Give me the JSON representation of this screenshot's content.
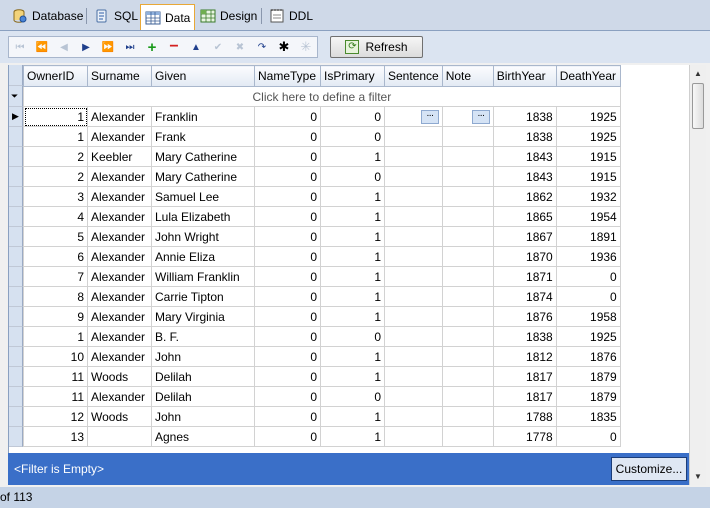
{
  "tabs": [
    {
      "label": "Database",
      "icon": "database-icon"
    },
    {
      "label": "SQL",
      "icon": "sql-scroll-icon"
    },
    {
      "label": "Data",
      "icon": "data-grid-icon",
      "active": true
    },
    {
      "label": "Design",
      "icon": "design-grid-icon"
    },
    {
      "label": "DDL",
      "icon": "ddl-notepad-icon"
    }
  ],
  "toolbar": {
    "refresh_label": "Refresh"
  },
  "grid": {
    "filter_placeholder": "Click here to define a filter",
    "columns": [
      "OwnerID",
      "Surname",
      "Given",
      "NameType",
      "IsPrimary",
      "Sentence",
      "Note",
      "BirthYear",
      "DeathYear"
    ],
    "rows": [
      [
        "1",
        "Alexander",
        "Franklin",
        "0",
        "0",
        "...",
        "...",
        "1838",
        "1925"
      ],
      [
        "1",
        "Alexander",
        "Frank",
        "0",
        "0",
        "",
        "",
        "1838",
        "1925"
      ],
      [
        "2",
        "Keebler",
        "Mary Catherine",
        "0",
        "1",
        "",
        "",
        "1843",
        "1915"
      ],
      [
        "2",
        "Alexander",
        "Mary Catherine",
        "0",
        "0",
        "",
        "",
        "1843",
        "1915"
      ],
      [
        "3",
        "Alexander",
        "Samuel Lee",
        "0",
        "1",
        "",
        "",
        "1862",
        "1932"
      ],
      [
        "4",
        "Alexander",
        "Lula Elizabeth",
        "0",
        "1",
        "",
        "",
        "1865",
        "1954"
      ],
      [
        "5",
        "Alexander",
        "John Wright",
        "0",
        "1",
        "",
        "",
        "1867",
        "1891"
      ],
      [
        "6",
        "Alexander",
        "Annie Eliza",
        "0",
        "1",
        "",
        "",
        "1870",
        "1936"
      ],
      [
        "7",
        "Alexander",
        "William Franklin",
        "0",
        "1",
        "",
        "",
        "1871",
        "0"
      ],
      [
        "8",
        "Alexander",
        "Carrie Tipton",
        "0",
        "1",
        "",
        "",
        "1874",
        "0"
      ],
      [
        "9",
        "Alexander",
        "Mary Virginia",
        "0",
        "1",
        "",
        "",
        "1876",
        "1958"
      ],
      [
        "1",
        "Alexander",
        "B. F.",
        "0",
        "0",
        "",
        "",
        "1838",
        "1925"
      ],
      [
        "10",
        "Alexander",
        "John",
        "0",
        "1",
        "",
        "",
        "1812",
        "1876"
      ],
      [
        "11",
        "Woods",
        "Delilah",
        "0",
        "1",
        "",
        "",
        "1817",
        "1879"
      ],
      [
        "11",
        "Alexander",
        "Delilah",
        "0",
        "0",
        "",
        "",
        "1817",
        "1879"
      ],
      [
        "12",
        "Woods",
        "John",
        "0",
        "1",
        "",
        "",
        "1788",
        "1835"
      ],
      [
        "13",
        "",
        "Agnes",
        "0",
        "1",
        "",
        "",
        "1778",
        "0"
      ]
    ]
  },
  "filterbar": {
    "text": "<Filter is Empty>",
    "customize_label": "Customize..."
  },
  "status": {
    "text": "of 113"
  },
  "colors": {
    "accent": "#3a6fc8",
    "header": "#e2e9f3",
    "active_tab_border": "#e8a837"
  }
}
